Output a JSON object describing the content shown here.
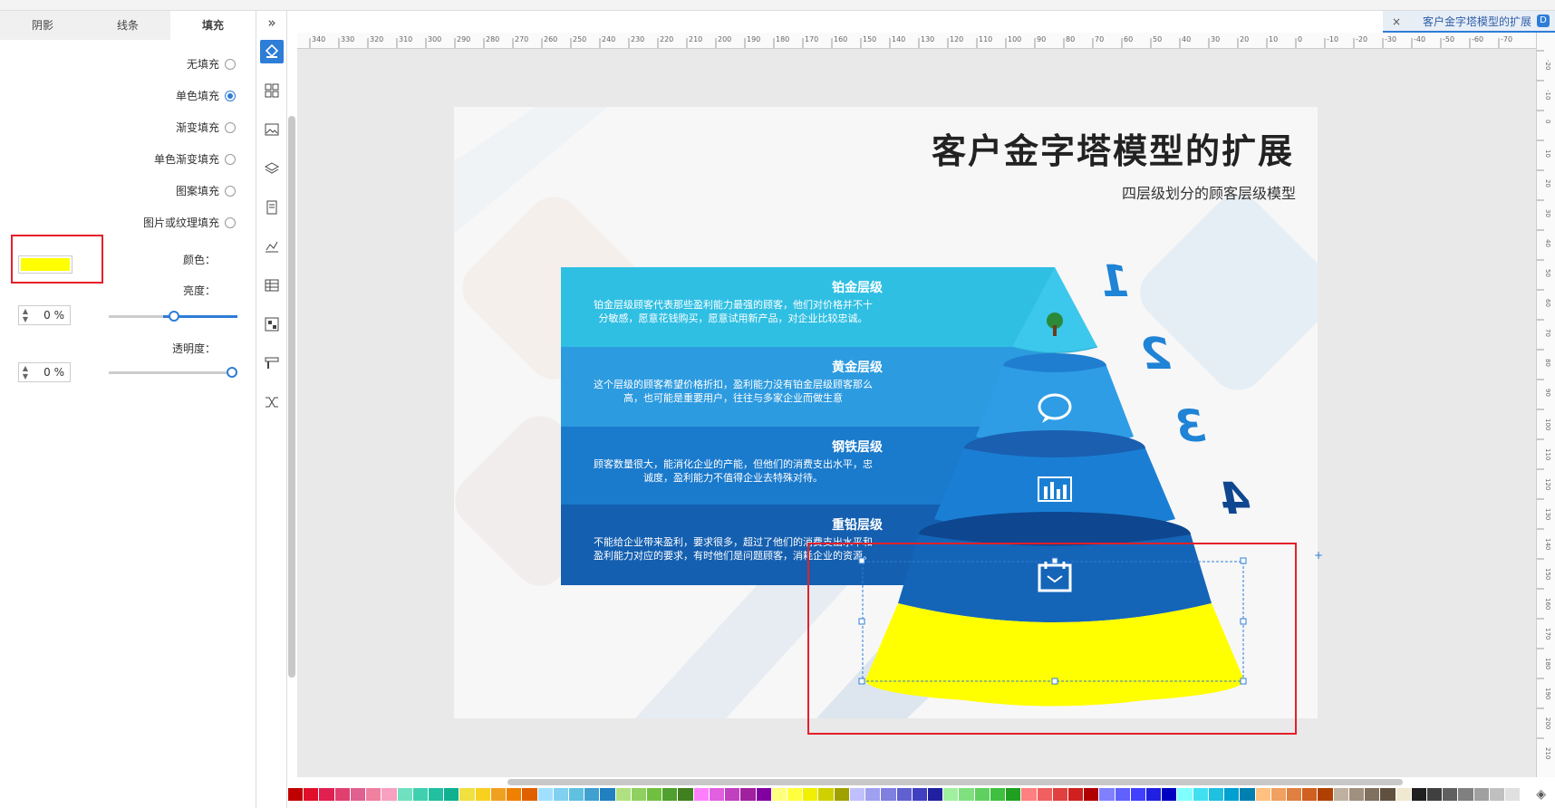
{
  "document_tab": {
    "title": "客户金字塔模型的扩展",
    "close": "×",
    "icon": "document-icon"
  },
  "panel": {
    "tabs": [
      "阴影",
      "线条",
      "填充"
    ],
    "active_tab": "填充",
    "fill_options": [
      {
        "label": "无填充",
        "selected": false
      },
      {
        "label": "单色填充",
        "selected": true
      },
      {
        "label": "渐变填充",
        "selected": false
      },
      {
        "label": "单色渐变填充",
        "selected": false
      },
      {
        "label": "图案填充",
        "selected": false
      },
      {
        "label": "图片或纹理填充",
        "selected": false
      }
    ],
    "color_label": "颜色：",
    "color_value": "#FFFF00",
    "brightness_label": "亮度：",
    "brightness_value": "0 %",
    "transparency_label": "透明度：",
    "transparency_value": "0 %"
  },
  "iconbar": [
    "fill-icon",
    "grid-icon",
    "image-icon",
    "layers-icon",
    "page-icon",
    "chart-icon",
    "table-icon",
    "structure-icon",
    "format-icon",
    "shuffle-icon"
  ],
  "collapse_glyph": "»",
  "ruler": {
    "h_labels": [
      "340",
      "330",
      "320",
      "310",
      "300",
      "290",
      "280",
      "270",
      "260",
      "250",
      "240",
      "230",
      "220",
      "210",
      "200",
      "190",
      "180",
      "170",
      "160",
      "150",
      "140",
      "130",
      "120",
      "110",
      "100",
      "90",
      "80",
      "70",
      "60",
      "50",
      "40",
      "30",
      "20",
      "10",
      "0",
      "-10",
      "-20",
      "-30",
      "-40",
      "-50",
      "-60",
      "-70"
    ],
    "v_labels": [
      "-20",
      "-10",
      "0",
      "10",
      "20",
      "30",
      "40",
      "50",
      "60",
      "70",
      "80",
      "90",
      "100",
      "110",
      "120",
      "130",
      "140",
      "150",
      "160",
      "170",
      "180",
      "190",
      "200",
      "210"
    ]
  },
  "slide": {
    "title": "客户金字塔模型的扩展",
    "subtitle": "四层级划分的顾客层级模型",
    "tiers": [
      {
        "num": "1",
        "title": "铂金层级",
        "desc": "铂金层级顾客代表那些盈利能力最强的顾客，他们对价格并不十分敏感，愿意花钱购买，愿意试用新产品，对企业比较忠诚。",
        "color": "#2fbfe3",
        "icon": "tree-icon"
      },
      {
        "num": "2",
        "title": "黄金层级",
        "desc": "这个层级的顾客希望价格折扣，盈利能力没有铂金层级顾客那么高，也可能是重要用户，往往与多家企业而做生意",
        "color": "#2d9be0",
        "icon": "chat-icon"
      },
      {
        "num": "3",
        "title": "钢铁层级",
        "desc": "顾客数量很大，能消化企业的产能，但他们的消费支出水平，忠诚度，盈利能力不值得企业去特殊对待。",
        "color": "#1a7acc",
        "icon": "bar-chart-icon"
      },
      {
        "num": "4",
        "title": "重铅层级",
        "desc": "不能给企业带来盈利，要求很多，超过了他们的消费支出水平和盈利能力对应的要求，有时他们是问题顾客，消耗企业的资源。",
        "color": "#145fb0",
        "icon": "calendar-icon"
      }
    ],
    "selected_fill": "#ffff00"
  },
  "palette": [
    "#c00000",
    "#e0102a",
    "#e02050",
    "#e04070",
    "#e06090",
    "#f080a0",
    "#f8a0c0",
    "#70e0c0",
    "#40d0b0",
    "#20c0a0",
    "#10b090",
    "#f0e040",
    "#f8d020",
    "#f0a020",
    "#f08000",
    "#e06000",
    "#a0e0ff",
    "#80d0f0",
    "#60c0e0",
    "#40a0d0",
    "#2080c0",
    "#b0e080",
    "#90d060",
    "#70c040",
    "#50a030",
    "#408020",
    "#ff80ff",
    "#e060e0",
    "#c040c0",
    "#a020a0",
    "#8000a0",
    "#ffff80",
    "#ffff40",
    "#f0f000",
    "#d0d000",
    "#a0a000",
    "#c0c0ff",
    "#a0a0f0",
    "#8080e0",
    "#6060d0",
    "#4040c0",
    "#2020a0",
    "#a0f0a0",
    "#80e080",
    "#60d060",
    "#40c040",
    "#20a020",
    "#ff8080",
    "#f06060",
    "#e04040",
    "#d02020",
    "#b00000",
    "#8080ff",
    "#6060ff",
    "#4040ff",
    "#2020e0",
    "#0000c0",
    "#80ffff",
    "#40e0f0",
    "#20c0e0",
    "#00a0d0",
    "#0080b0",
    "#ffc080",
    "#f0a060",
    "#e08040",
    "#d06020",
    "#b04000",
    "#c0b0a0",
    "#a09080",
    "#807060",
    "#605040",
    "#f0e8d0",
    "#202020",
    "#404040",
    "#606060",
    "#808080",
    "#a0a0a0",
    "#c0c0c0",
    "#e0e0e0",
    "#ffffff"
  ],
  "fill_icon_glyph": "◈"
}
